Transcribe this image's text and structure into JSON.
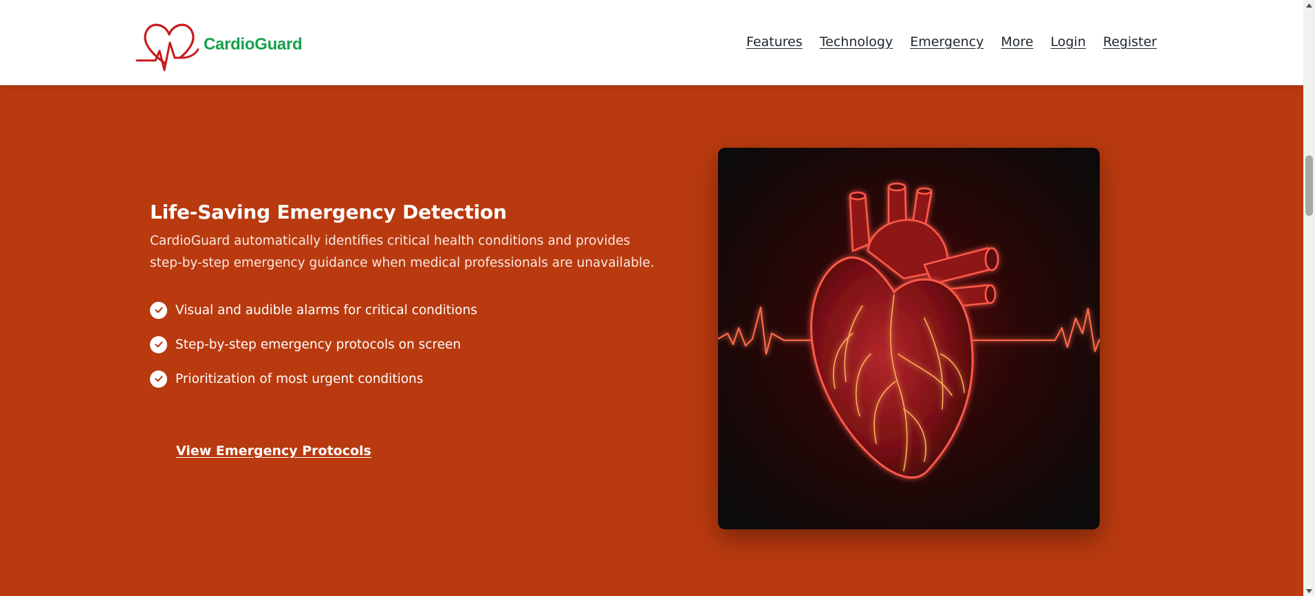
{
  "brand": {
    "name": "CardioGuard",
    "logo_icon": "heart-pulse-logo-icon",
    "logo_color": "#c8191d",
    "name_color": "#14a14b"
  },
  "nav": {
    "items": [
      {
        "label": "Features"
      },
      {
        "label": "Technology"
      },
      {
        "label": "Emergency"
      },
      {
        "label": "More"
      },
      {
        "label": "Login"
      },
      {
        "label": "Register"
      }
    ]
  },
  "hero": {
    "background_color": "#b93a0f",
    "title": "Life-Saving Emergency Detection",
    "description": "CardioGuard automatically identifies critical health conditions and provides step-by-step emergency guidance when medical professionals are unavailable.",
    "features": [
      {
        "icon": "check-circle-icon",
        "text": "Visual and audible alarms for critical conditions"
      },
      {
        "icon": "check-circle-icon",
        "text": "Step-by-step emergency protocols on screen"
      },
      {
        "icon": "check-circle-icon",
        "text": "Prioritization of most urgent conditions"
      }
    ],
    "cta_label": "View Emergency Protocols",
    "image": {
      "icon": "glowing-heart-ecg-illustration"
    }
  }
}
